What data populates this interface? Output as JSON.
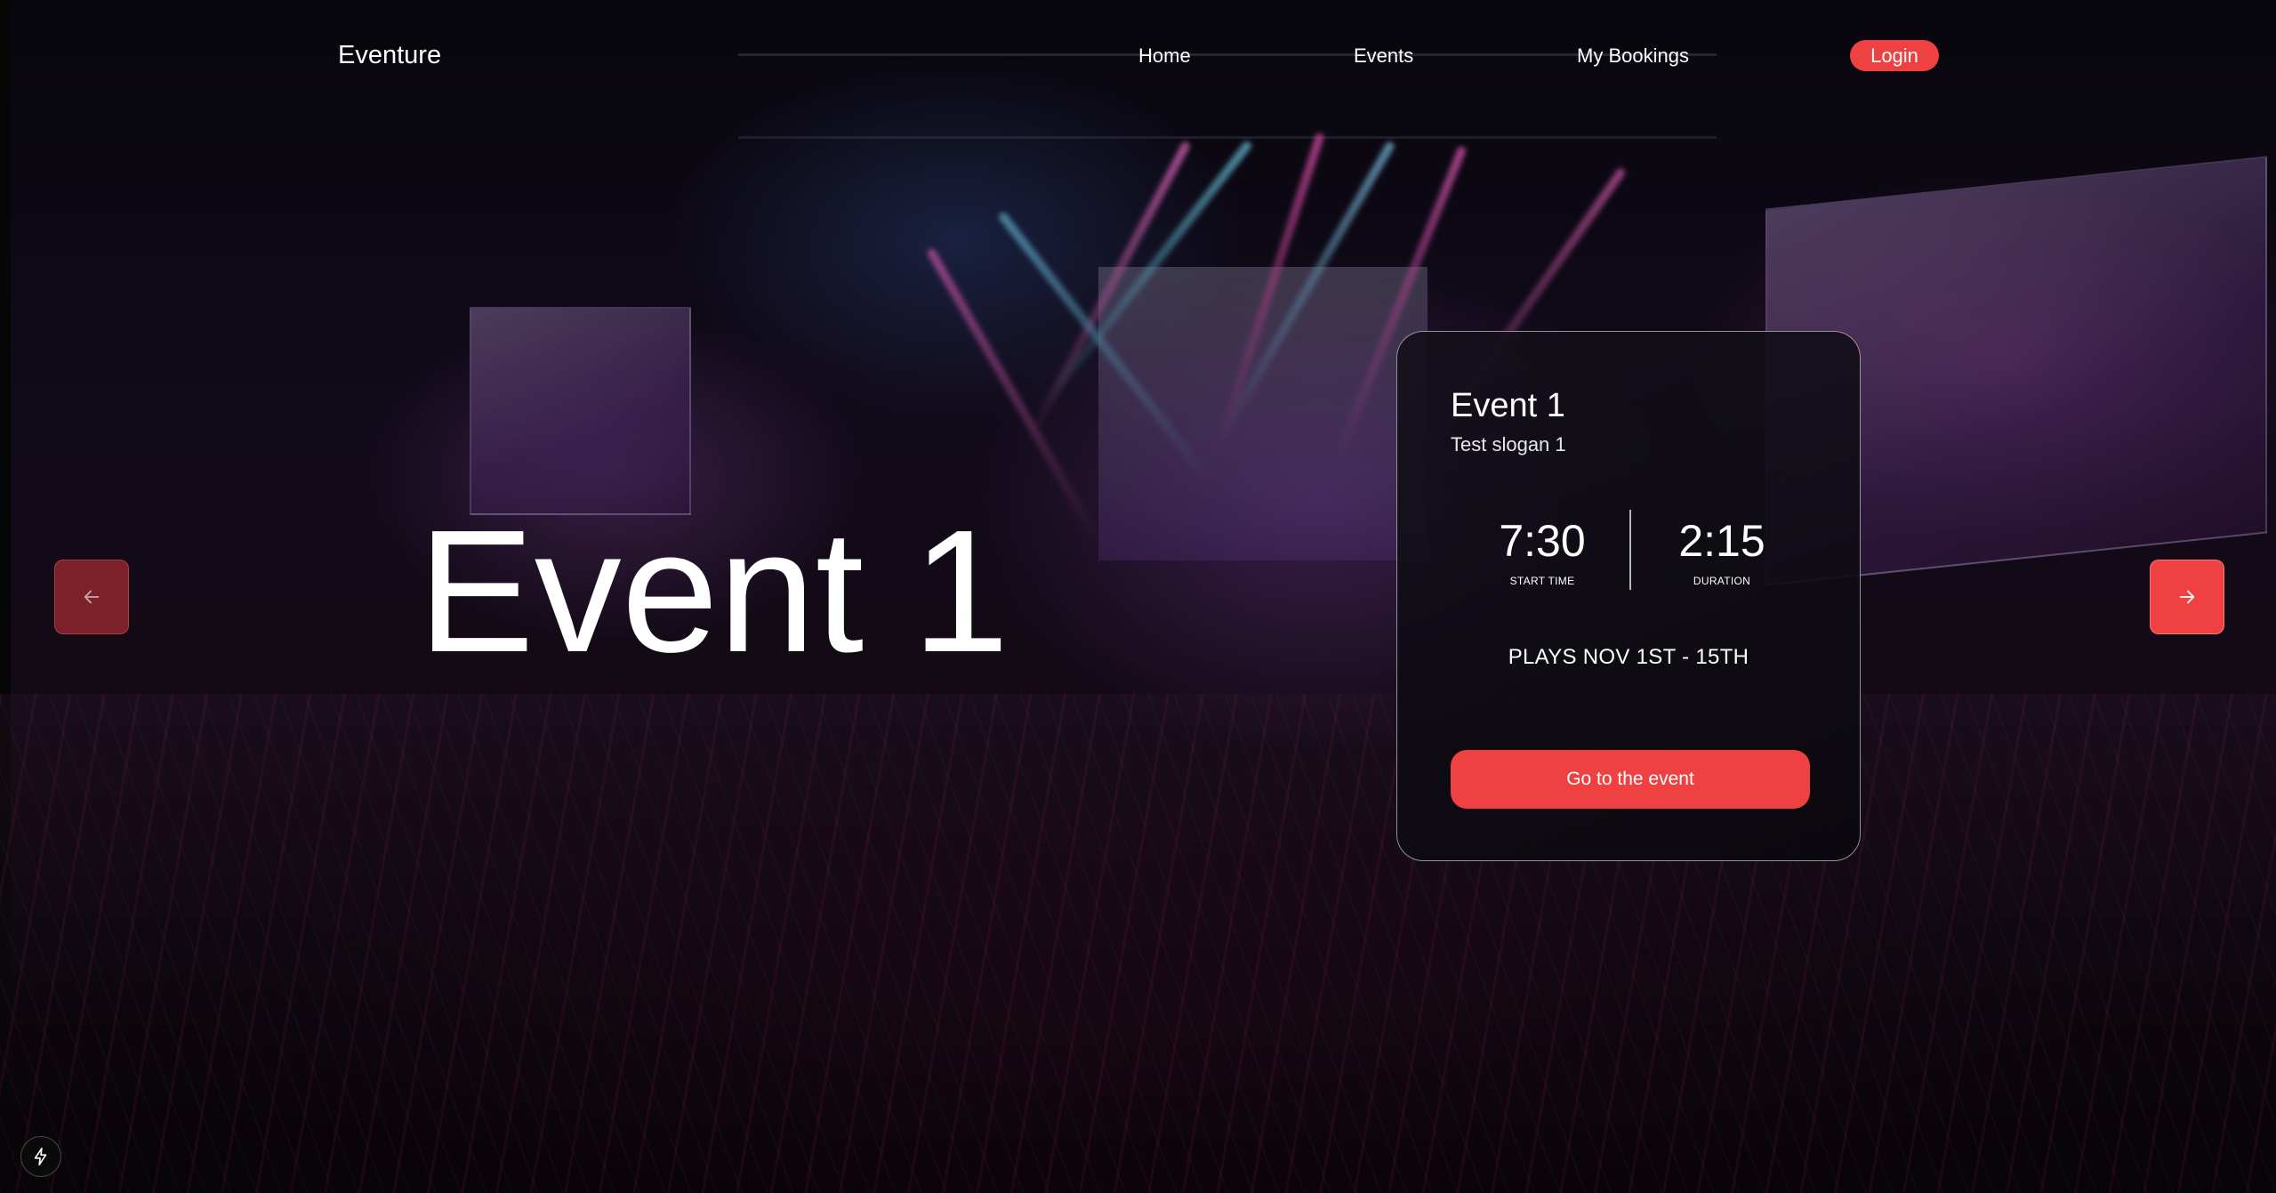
{
  "nav": {
    "brand": "Eventure",
    "links": [
      {
        "label": "Home"
      },
      {
        "label": "Events"
      },
      {
        "label": "My Bookings"
      }
    ],
    "login_label": "Login"
  },
  "hero": {
    "title": "Event 1",
    "prev_icon": "arrow-left-icon",
    "next_icon": "arrow-right-icon"
  },
  "card": {
    "title": "Event 1",
    "slogan": "Test slogan 1",
    "start_time": {
      "value": "7:30",
      "label": "START TIME"
    },
    "duration": {
      "value": "2:15",
      "label": "DURATION"
    },
    "plays": "PLAYS NOV 1ST - 15TH",
    "cta_label": "Go to the event"
  },
  "dev_indicator": {
    "icon": "lightning-bolt-icon"
  },
  "colors": {
    "accent": "#ef4141",
    "text": "#ffffff",
    "card_bg": "#120e18"
  }
}
